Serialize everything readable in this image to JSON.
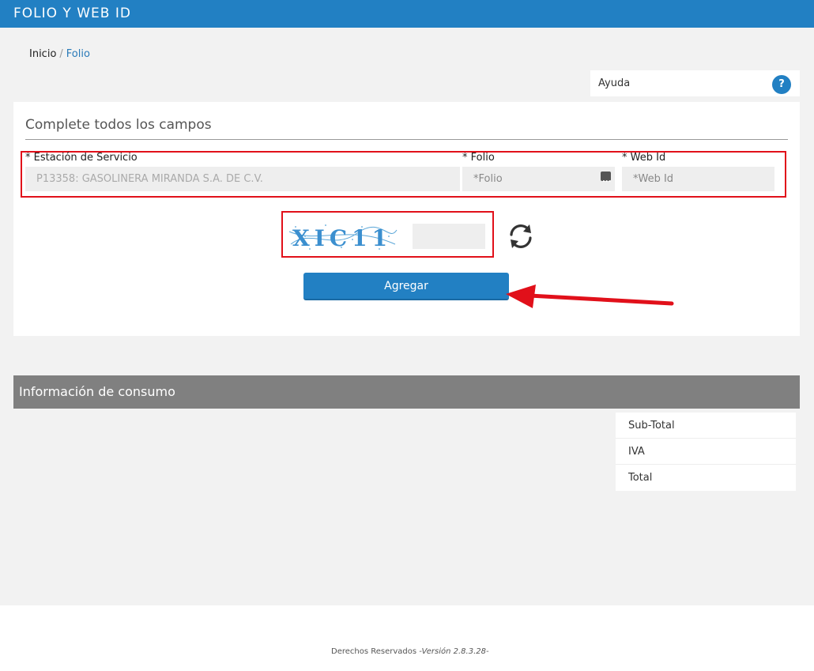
{
  "header": {
    "title": "FOLIO Y WEB ID"
  },
  "breadcrumb": {
    "home": "Inicio",
    "separator": "/",
    "current": "Folio"
  },
  "help": {
    "label": "Ayuda",
    "icon_text": "?"
  },
  "form": {
    "heading": "Complete todos los campos",
    "estacion_label": "* Estación de Servicio",
    "estacion_value": "P13358: GASOLINERA MIRANDA S.A. DE C.V.",
    "folio_label": "* Folio",
    "folio_placeholder": "*Folio",
    "webid_label": "* Web Id",
    "webid_placeholder": "*Web Id",
    "captcha_text": "XIC11",
    "agregar_label": "Agregar"
  },
  "info": {
    "title": "Información de consumo",
    "totals": [
      "Sub-Total",
      "IVA",
      "Total"
    ]
  },
  "footer": {
    "text": "Derechos Reservados",
    "version": "-Versión 2.8.3.28-"
  },
  "colors": {
    "brand": "#2280c3",
    "highlight": "#e1101a",
    "section_header": "#808080"
  }
}
